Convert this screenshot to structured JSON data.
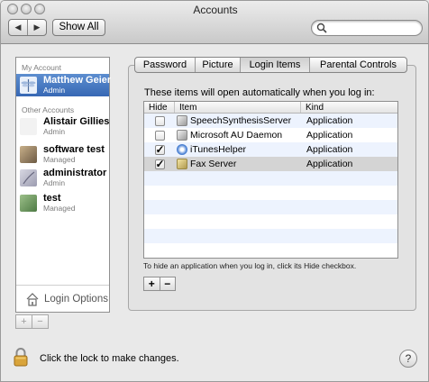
{
  "window": {
    "title": "Accounts"
  },
  "toolbar": {
    "back_glyph": "◀",
    "forward_glyph": "▶",
    "show_all_label": "Show All",
    "search": {
      "value": "",
      "placeholder": ""
    }
  },
  "sidebar": {
    "my_account_header": "My Account",
    "my_account": {
      "name": "Matthew Geier",
      "role": "Admin",
      "icon": "dragonfly-picture"
    },
    "other_accounts_header": "Other Accounts",
    "others": [
      {
        "name": "Alistair Gillies",
        "role": "Admin",
        "icon": "gray-picture"
      },
      {
        "name": "software test",
        "role": "Managed",
        "icon": "dog-picture"
      },
      {
        "name": "administrator",
        "role": "Admin",
        "icon": "feather-picture"
      },
      {
        "name": "test",
        "role": "Managed",
        "icon": "leaf-picture"
      }
    ],
    "login_options_label": "Login Options",
    "add_label": "+",
    "remove_label": "−"
  },
  "tabs": [
    {
      "label": "Password",
      "active": false
    },
    {
      "label": "Picture",
      "active": false
    },
    {
      "label": "Login Items",
      "active": true
    },
    {
      "label": "Parental Controls",
      "active": false
    }
  ],
  "login_items": {
    "intro": "These items will open automatically when you log in:",
    "columns": [
      "Hide",
      "Item",
      "Kind"
    ],
    "rows": [
      {
        "hide": false,
        "item": "SpeechSynthesisServer",
        "kind": "Application",
        "icon": "app-icon"
      },
      {
        "hide": false,
        "item": "Microsoft AU Daemon",
        "kind": "Application",
        "icon": "app-icon"
      },
      {
        "hide": true,
        "item": "iTunesHelper",
        "kind": "Application",
        "icon": "itunes-icon"
      },
      {
        "hide": true,
        "item": "Fax Server",
        "kind": "Application",
        "icon": "fax-icon"
      }
    ],
    "checkmark": "✓",
    "hint": "To hide an application when you log in, click its Hide checkbox.",
    "add_label": "+",
    "remove_label": "−"
  },
  "footer": {
    "lock_text": "Click the lock to make changes.",
    "help_label": "?"
  },
  "colors": {
    "selection": "#3f72bd",
    "stripe": "#edf3fe",
    "selected_row": "#d4d4d4"
  }
}
